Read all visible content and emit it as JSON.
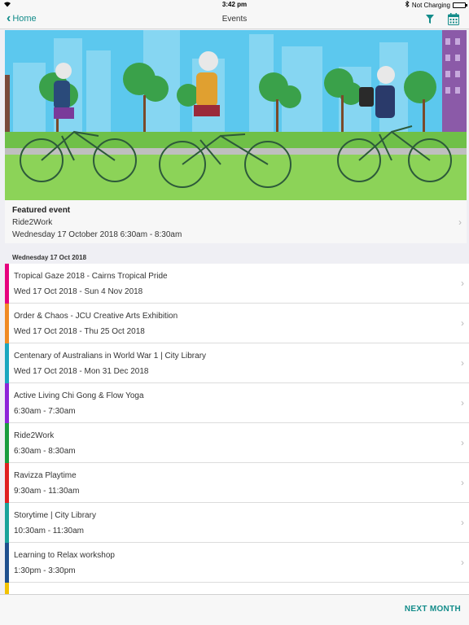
{
  "status_bar": {
    "time": "3:42 pm",
    "battery_text": "Not Charging"
  },
  "nav": {
    "back_label": "Home",
    "title": "Events"
  },
  "featured": {
    "heading": "Featured event",
    "title": "Ride2Work",
    "date": "Wednesday 17 October 2018 6:30am - 8:30am"
  },
  "section_header": "Wednesday 17 Oct 2018",
  "events": [
    {
      "title": "Tropical Gaze 2018 - Cairns Tropical Pride",
      "date": "Wed 17 Oct 2018 - Sun 4 Nov 2018",
      "color": "#e6007e"
    },
    {
      "title": "Order & Chaos - JCU Creative Arts Exhibition",
      "date": "Wed 17 Oct 2018 - Thu 25 Oct 2018",
      "color": "#f08a24"
    },
    {
      "title": "Centenary of Australians in World War 1 | City Library",
      "date": "Wed 17 Oct 2018 - Mon 31 Dec 2018",
      "color": "#1ba6bf"
    },
    {
      "title": "Active Living Chi Gong & Flow Yoga",
      "date": "6:30am - 7:30am",
      "color": "#8e24d8"
    },
    {
      "title": "Ride2Work",
      "date": "6:30am - 8:30am",
      "color": "#1a9c3e"
    },
    {
      "title": "Ravizza Playtime",
      "date": "9:30am - 11:30am",
      "color": "#e02020"
    },
    {
      "title": "Storytime | City Library",
      "date": "10:30am - 11:30am",
      "color": "#1aa39a"
    },
    {
      "title": "Learning to Relax workshop",
      "date": "1:30pm - 3:30pm",
      "color": "#1f4f8f"
    },
    {
      "title": "",
      "date": "",
      "color": "#f2c200"
    }
  ],
  "bottom": {
    "next_month_label": "NEXT MONTH"
  },
  "colors": {
    "accent": "#138c8a"
  }
}
